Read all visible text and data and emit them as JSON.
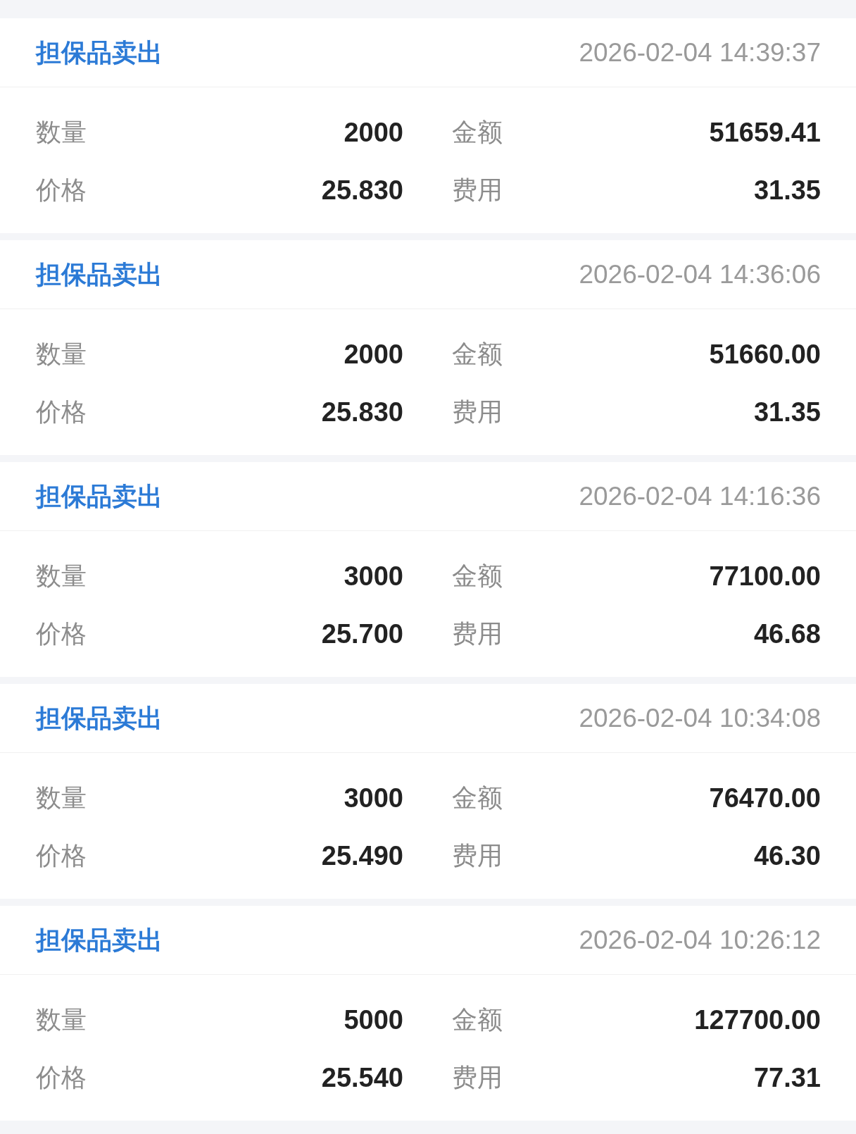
{
  "records": [
    {
      "title": "担保品卖出",
      "time": "2026-02-04 14:39:37",
      "rows": [
        {
          "label_1": "数量",
          "value_1": "2000",
          "label_2": "金额",
          "value_2": "51659.41"
        },
        {
          "label_1": "价格",
          "value_1": "25.830",
          "label_2": "费用",
          "value_2": "31.35"
        }
      ]
    },
    {
      "title": "担保品卖出",
      "time": "2026-02-04 14:36:06",
      "rows": [
        {
          "label_1": "数量",
          "value_1": "2000",
          "label_2": "金额",
          "value_2": "51660.00"
        },
        {
          "label_1": "价格",
          "value_1": "25.830",
          "label_2": "费用",
          "value_2": "31.35"
        }
      ]
    },
    {
      "title": "担保品卖出",
      "time": "2026-02-04 14:16:36",
      "rows": [
        {
          "label_1": "数量",
          "value_1": "3000",
          "label_2": "金额",
          "value_2": "77100.00"
        },
        {
          "label_1": "价格",
          "value_1": "25.700",
          "label_2": "费用",
          "value_2": "46.68"
        }
      ]
    },
    {
      "title": "担保品卖出",
      "time": "2026-02-04 10:34:08",
      "rows": [
        {
          "label_1": "数量",
          "value_1": "3000",
          "label_2": "金额",
          "value_2": "76470.00"
        },
        {
          "label_1": "价格",
          "value_1": "25.490",
          "label_2": "费用",
          "value_2": "46.30"
        }
      ]
    },
    {
      "title": "担保品卖出",
      "time": "2026-02-04 10:26:12",
      "rows": [
        {
          "label_1": "数量",
          "value_1": "5000",
          "label_2": "金额",
          "value_2": "127700.00"
        },
        {
          "label_1": "价格",
          "value_1": "25.540",
          "label_2": "费用",
          "value_2": "77.31"
        }
      ]
    }
  ]
}
